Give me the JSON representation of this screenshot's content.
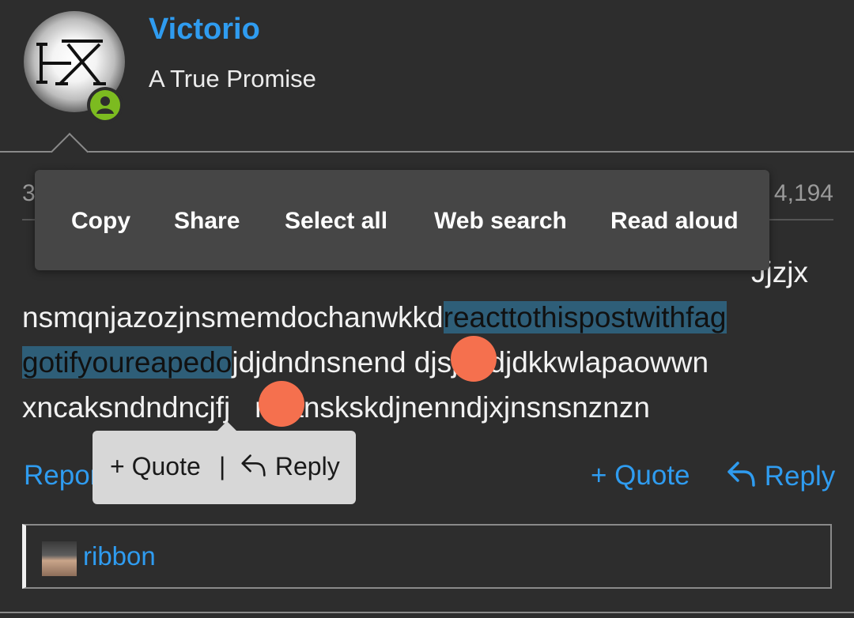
{
  "user": {
    "name": "Victorio",
    "title": "A True Promise",
    "avatar_text": "HX"
  },
  "meta": {
    "left": "3",
    "right": "4,194"
  },
  "post": {
    "line1": "Jjzjx",
    "line2_plain": "nsmqnjazozjnsmemdochanwkkd",
    "line2_selected": "reacttothispostwithfag",
    "line3_selected": "gotifyoureapedo",
    "line3_plain": "jdjdndnsnend djsjsndjdkkwlapaowwn",
    "line4": "xncaksndndncjfj   nbanskskdjnenndjxjnsnsnznzn"
  },
  "context_menu": {
    "items": [
      "Copy",
      "Share",
      "Select all",
      "Web search",
      "Read aloud"
    ]
  },
  "quote_popup": {
    "quote": "+ Quote",
    "separator": "|",
    "reply": "Reply"
  },
  "actions": {
    "report": "Report",
    "quote": "+ Quote",
    "reply": "Reply"
  },
  "reactions": {
    "user": "ribbon"
  },
  "colors": {
    "accent": "#2f9cf0",
    "selection": "#2e5e78",
    "handle": "#f5704e",
    "online": "#7cbb20"
  }
}
